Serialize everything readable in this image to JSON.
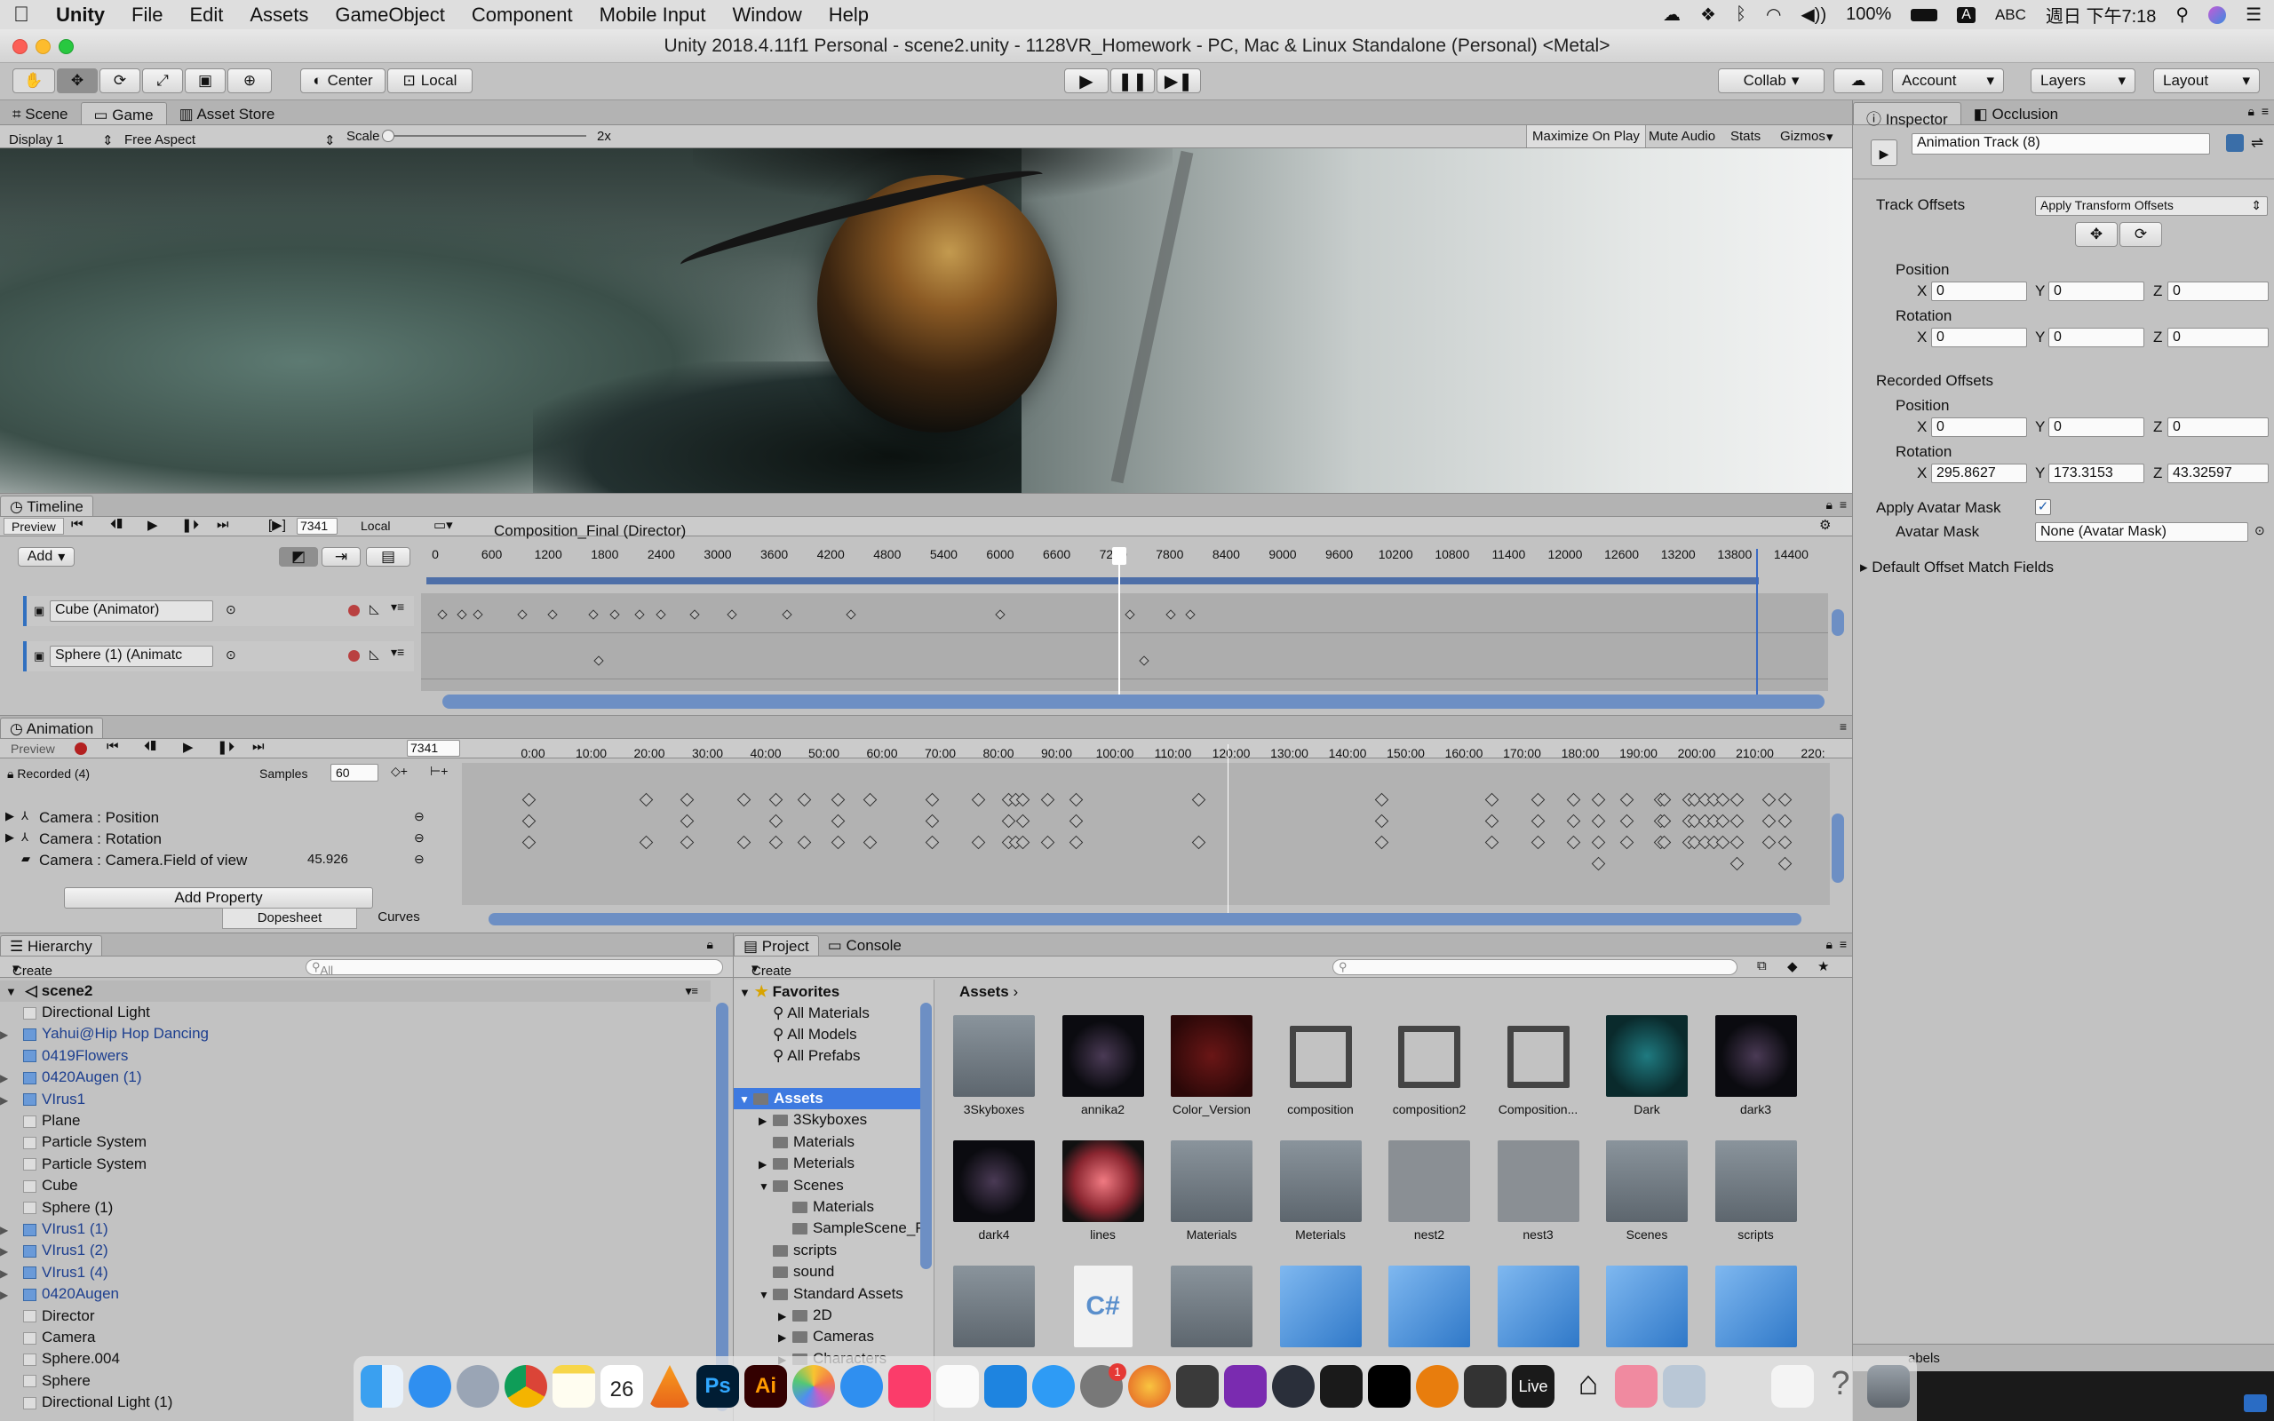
{
  "menubar": {
    "app": "Unity",
    "items": [
      "File",
      "Edit",
      "Assets",
      "GameObject",
      "Component",
      "Mobile Input",
      "Window",
      "Help"
    ],
    "battery": "100%",
    "input": "ABC",
    "clock": "週日 下午7:18"
  },
  "title": "Unity 2018.4.11f1 Personal - scene2.unity - 1128VR_Homework - PC, Mac & Linux Standalone (Personal) <Metal>",
  "toolbar": {
    "pivot": "Center",
    "space": "Local",
    "collab": "Collab",
    "account": "Account",
    "layers": "Layers",
    "layout": "Layout"
  },
  "game": {
    "tabs": [
      "Scene",
      "Game",
      "Asset Store"
    ],
    "display": "Display 1",
    "aspect": "Free Aspect",
    "scale_label": "Scale",
    "scale_value": "2x",
    "buttons": [
      "Maximize On Play",
      "Mute Audio",
      "Stats",
      "Gizmos"
    ]
  },
  "timeline": {
    "tab": "Timeline",
    "preview": "Preview",
    "frame": "7341",
    "space": "Local",
    "director": "Composition_Final (Director)",
    "add": "Add",
    "ticks": [
      "0",
      "600",
      "1200",
      "1800",
      "2400",
      "3000",
      "3600",
      "4200",
      "4800",
      "5400",
      "6000",
      "6600",
      "7200",
      "7800",
      "8400",
      "9000",
      "9600",
      "10200",
      "10800",
      "11400",
      "12000",
      "12600",
      "13200",
      "13800",
      "14400"
    ],
    "tracks": [
      "Cube (Animator)",
      "Sphere (1) (Animatc"
    ]
  },
  "animation": {
    "tab": "Animation",
    "preview": "Preview",
    "frame": "7341",
    "clip": "Recorded (4)",
    "samples_label": "Samples",
    "samples": "60",
    "ticks": [
      "0:00",
      "10:00",
      "20:00",
      "30:00",
      "40:00",
      "50:00",
      "60:00",
      "70:00",
      "80:00",
      "90:00",
      "100:00",
      "110:00",
      "120:00",
      "130:00",
      "140:00",
      "150:00",
      "160:00",
      "170:00",
      "180:00",
      "190:00",
      "200:00",
      "210:00",
      "220:"
    ],
    "properties": [
      {
        "name": "Camera : Position",
        "value": ""
      },
      {
        "name": "Camera : Rotation",
        "value": ""
      },
      {
        "name": "Camera : Camera.Field of view",
        "value": "45.926"
      }
    ],
    "add_property": "Add Property",
    "modes": [
      "Dopesheet",
      "Curves"
    ]
  },
  "hierarchy": {
    "tab": "Hierarchy",
    "create": "Create",
    "search": "All",
    "scene": "scene2",
    "items": [
      {
        "name": "Directional Light",
        "prefab": false,
        "arrow": false
      },
      {
        "name": "Yahui@Hip Hop Dancing",
        "prefab": true,
        "arrow": true
      },
      {
        "name": "0419Flowers",
        "prefab": true,
        "arrow": false
      },
      {
        "name": "0420Augen (1)",
        "prefab": true,
        "arrow": true
      },
      {
        "name": "VIrus1",
        "prefab": true,
        "arrow": true
      },
      {
        "name": "Plane",
        "prefab": false,
        "arrow": false
      },
      {
        "name": "Particle System",
        "prefab": false,
        "arrow": false
      },
      {
        "name": "Particle System",
        "prefab": false,
        "arrow": false
      },
      {
        "name": "Cube",
        "prefab": false,
        "arrow": false
      },
      {
        "name": "Sphere (1)",
        "prefab": false,
        "arrow": false
      },
      {
        "name": "VIrus1 (1)",
        "prefab": true,
        "arrow": true
      },
      {
        "name": "VIrus1 (2)",
        "prefab": true,
        "arrow": true
      },
      {
        "name": "VIrus1 (4)",
        "prefab": true,
        "arrow": true
      },
      {
        "name": "0420Augen",
        "prefab": true,
        "arrow": true
      },
      {
        "name": "Director",
        "prefab": false,
        "arrow": false
      },
      {
        "name": "Camera",
        "prefab": false,
        "arrow": false
      },
      {
        "name": "Sphere.004",
        "prefab": false,
        "arrow": false
      },
      {
        "name": "Sphere",
        "prefab": false,
        "arrow": false
      },
      {
        "name": "Directional Light (1)",
        "prefab": false,
        "arrow": false
      }
    ]
  },
  "project": {
    "tabs": [
      "Project",
      "Console"
    ],
    "create": "Create",
    "favorites": "Favorites",
    "fav_items": [
      "All Materials",
      "All Models",
      "All Prefabs"
    ],
    "tree": [
      {
        "name": "Assets",
        "depth": 0,
        "sel": true,
        "arrow": "▼"
      },
      {
        "name": "3Skyboxes",
        "depth": 1,
        "sel": false,
        "arrow": "▶"
      },
      {
        "name": "Materials",
        "depth": 1,
        "sel": false,
        "arrow": ""
      },
      {
        "name": "Meterials",
        "depth": 1,
        "sel": false,
        "arrow": "▶"
      },
      {
        "name": "Scenes",
        "depth": 1,
        "sel": false,
        "arrow": "▼"
      },
      {
        "name": "Materials",
        "depth": 2,
        "sel": false,
        "arrow": ""
      },
      {
        "name": "SampleScene_Pr",
        "depth": 2,
        "sel": false,
        "arrow": ""
      },
      {
        "name": "scripts",
        "depth": 1,
        "sel": false,
        "arrow": ""
      },
      {
        "name": "sound",
        "depth": 1,
        "sel": false,
        "arrow": ""
      },
      {
        "name": "Standard Assets",
        "depth": 1,
        "sel": false,
        "arrow": "▼"
      },
      {
        "name": "2D",
        "depth": 2,
        "sel": false,
        "arrow": "▶"
      },
      {
        "name": "Cameras",
        "depth": 2,
        "sel": false,
        "arrow": "▶"
      },
      {
        "name": "Characters",
        "depth": 2,
        "sel": false,
        "arrow": "▶"
      }
    ],
    "breadcrumb": "Assets",
    "assets": [
      {
        "name": "3Skyboxes",
        "kind": "folder"
      },
      {
        "name": "annika2",
        "kind": "dark"
      },
      {
        "name": "Color_Version",
        "kind": "red"
      },
      {
        "name": "composition",
        "kind": "timeline"
      },
      {
        "name": "composition2",
        "kind": "timeline"
      },
      {
        "name": "Composition...",
        "kind": "timeline"
      },
      {
        "name": "Dark",
        "kind": "teal"
      },
      {
        "name": "dark3",
        "kind": "dark"
      },
      {
        "name": "dark4",
        "kind": "dark"
      },
      {
        "name": "lines",
        "kind": "pink"
      },
      {
        "name": "Materials",
        "kind": "folder"
      },
      {
        "name": "Meterials",
        "kind": "folder"
      },
      {
        "name": "nest2",
        "kind": "model"
      },
      {
        "name": "nest3",
        "kind": "model"
      },
      {
        "name": "Scenes",
        "kind": "folder"
      },
      {
        "name": "scripts",
        "kind": "folder"
      },
      {
        "name": "",
        "kind": "folder"
      },
      {
        "name": "",
        "kind": "script"
      },
      {
        "name": "",
        "kind": "folder"
      },
      {
        "name": "",
        "kind": "prefab"
      },
      {
        "name": "",
        "kind": "prefab"
      },
      {
        "name": "",
        "kind": "prefab"
      },
      {
        "name": "",
        "kind": "prefab"
      },
      {
        "name": "",
        "kind": "prefab"
      }
    ]
  },
  "inspector": {
    "tabs": [
      "Inspector",
      "Occlusion"
    ],
    "name": "Animation Track (8)",
    "track_offsets": "Track Offsets",
    "offset_mode": "Apply Transform Offsets",
    "position": "Position",
    "rotation": "Rotation",
    "pos": [
      "0",
      "0",
      "0"
    ],
    "rot": [
      "0",
      "0",
      "0"
    ],
    "recorded": "Recorded Offsets",
    "rec_pos": [
      "0",
      "0",
      "0"
    ],
    "rec_rot": [
      "295.8627",
      "173.3153",
      "43.32597"
    ],
    "apply_mask": "Apply Avatar Mask",
    "avatar_mask": "Avatar Mask",
    "avatar_mask_value": "None (Avatar Mask)",
    "default_fields": "Default Offset Match Fields",
    "bottom": "abels",
    "axes": [
      "X",
      "Y",
      "Z"
    ]
  },
  "dock": {
    "badge": "1",
    "live": "Live",
    "calendar": "26",
    "ps": "Ps",
    "ai": "Ai"
  }
}
